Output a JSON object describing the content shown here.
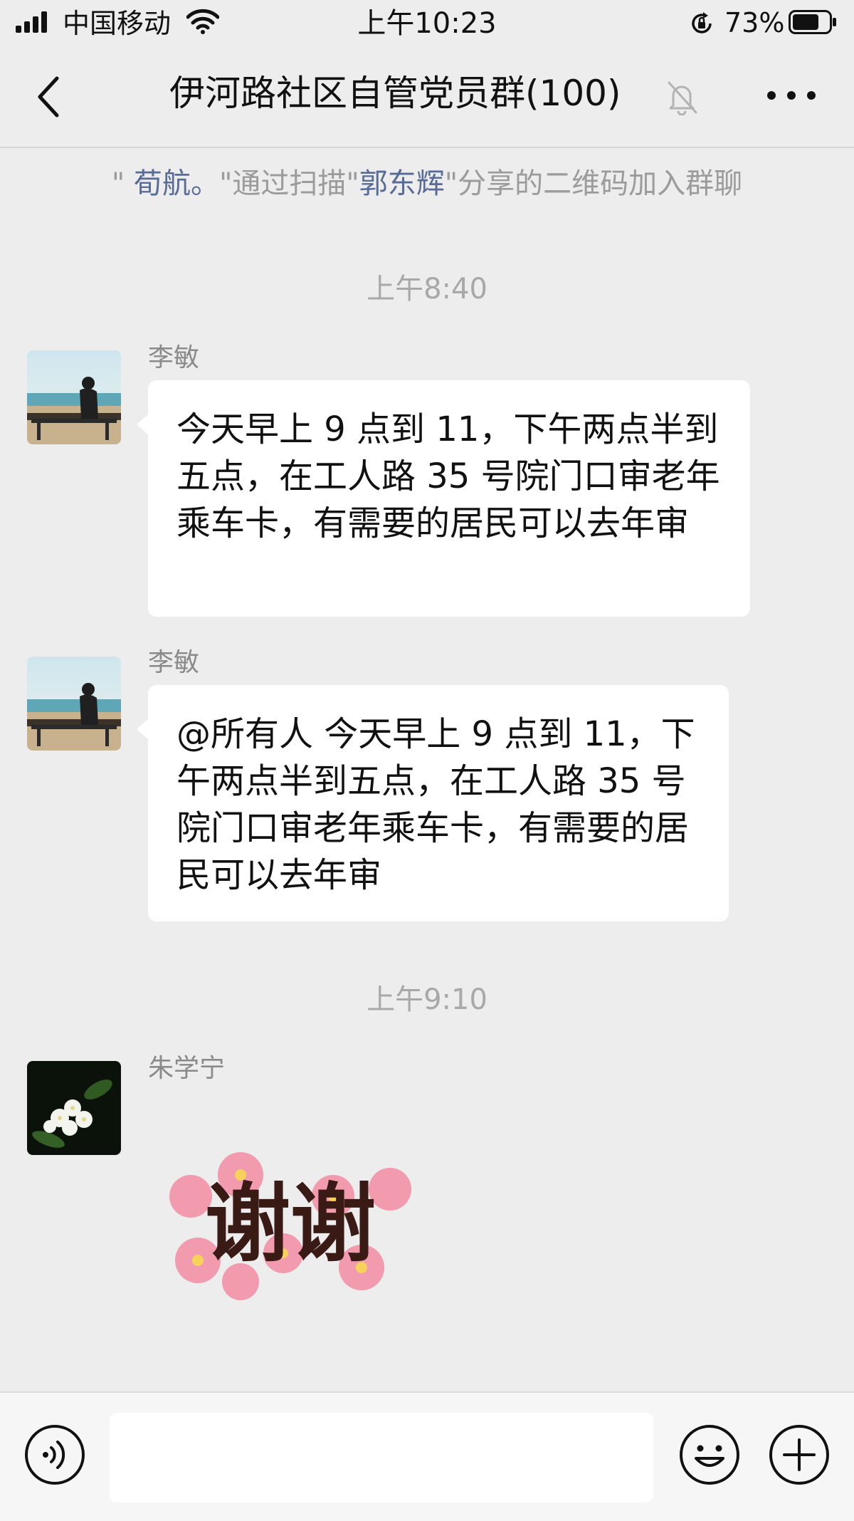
{
  "status_bar": {
    "carrier": "中国移动",
    "time": "上午10:23",
    "battery_percent": "73%",
    "battery_level": 0.73,
    "icons": [
      "signal-icon",
      "wifi-icon",
      "rotation-lock-icon",
      "battery-icon"
    ]
  },
  "nav": {
    "title": "伊河路社区自管党员群(100)",
    "icons": [
      "back-chevron-icon",
      "mute-bell-icon",
      "more-dots-icon"
    ]
  },
  "system_message": {
    "q1": "\" ",
    "name1": "荀航。",
    "mid": "\"通过扫描\"",
    "name2": "郭东辉",
    "tail": "\"分享的二维码加入群聊"
  },
  "messages": [
    {
      "timestamp": "上午8:40",
      "sender": "李敏",
      "text": "今天早上 9 点到 11，下午两点半到五点，在工人路 35 号院门口审老年乘车卡，有需要的居民可以去年审"
    },
    {
      "sender": "李敏",
      "text": "@所有人 今天早上 9 点到 11，下午两点半到五点，在工人路 35 号院门口审老年乘车卡，有需要的居民可以去年审"
    },
    {
      "timestamp": "上午9:10",
      "sender": "朱学宁",
      "sticker_text": "谢谢"
    }
  ],
  "input_bar": {
    "placeholder": "",
    "icons": [
      "voice-icon",
      "emoji-icon",
      "plus-icon"
    ]
  }
}
